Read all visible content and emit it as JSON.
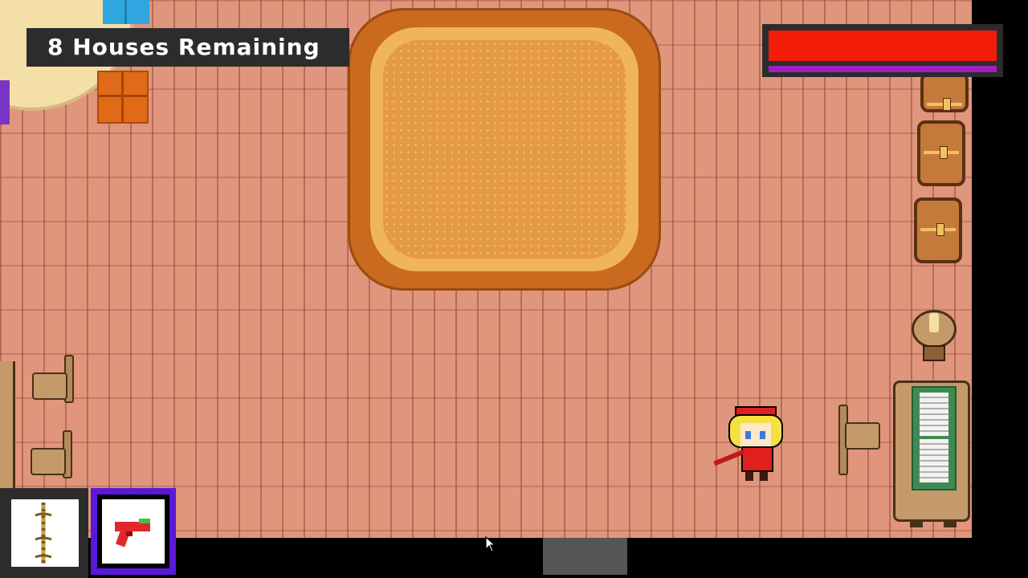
{
  "hud": {
    "houses_remaining_label": "8 Houses Remaining",
    "health_fraction": 1.0,
    "mana_fraction": 1.0
  },
  "inventory": {
    "slots": [
      {
        "item": "rope-item",
        "selected": false
      },
      {
        "item": "red-gun-item",
        "selected": true
      }
    ]
  },
  "colors": {
    "floor": "#e0967c",
    "health": "#f21c08",
    "mana": "#a020c0",
    "selected_slot": "#5a18d8",
    "hud_bg": "#2c2c2c"
  }
}
